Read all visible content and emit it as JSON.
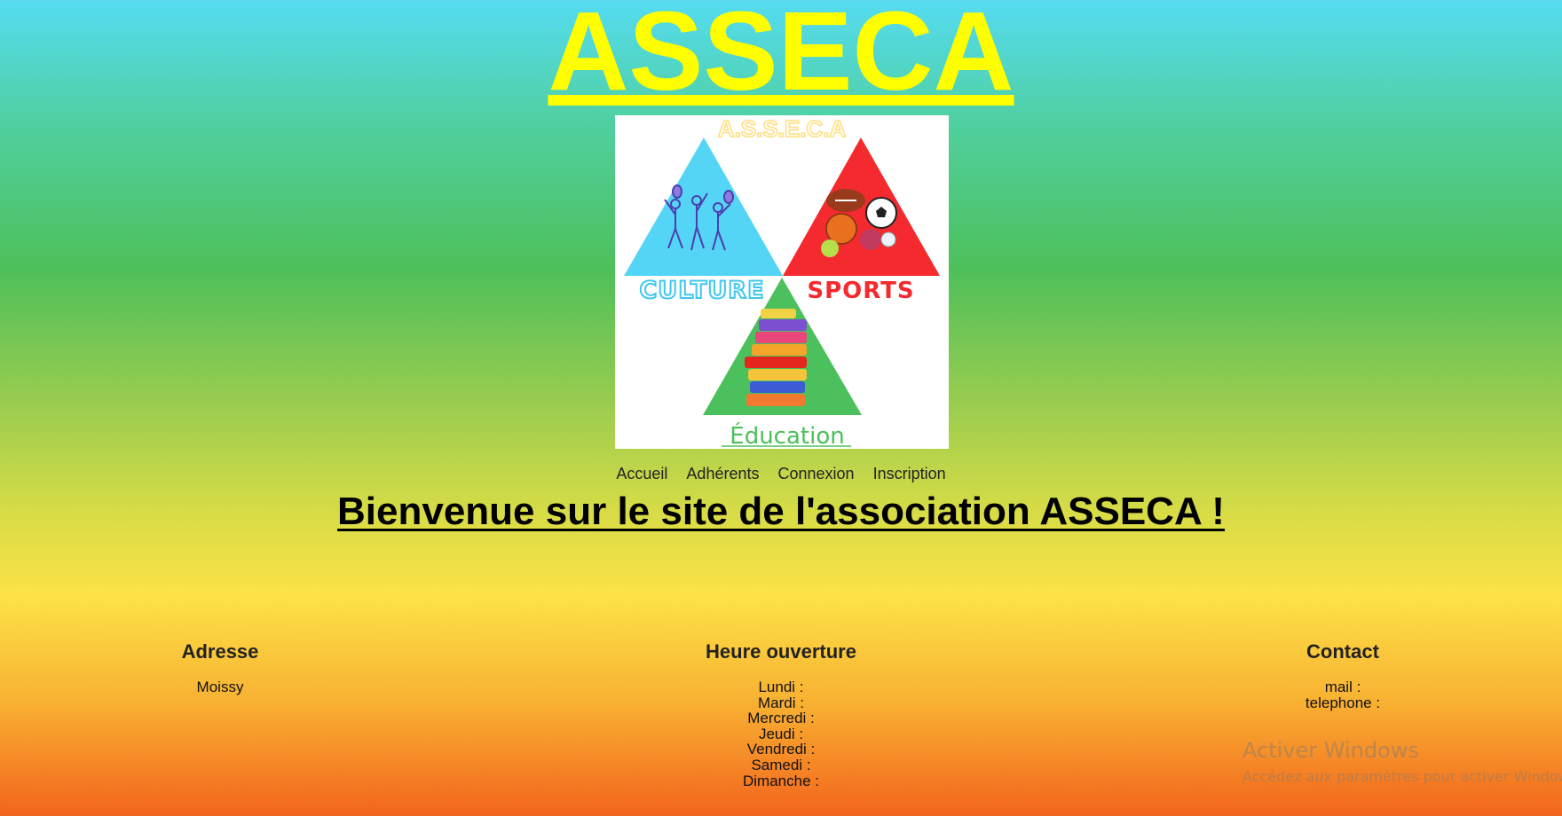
{
  "site": {
    "title": "ASSECA"
  },
  "logo": {
    "top_text": "A.S.S.E.C.A",
    "labels": {
      "culture": "CULTURE",
      "sports": "SPORTS",
      "education": "Éducation"
    },
    "colors": {
      "culture": "#55d5f5",
      "sports": "#f42a2f",
      "education": "#4bc05c",
      "top_text": "#ffe083"
    }
  },
  "nav": {
    "items": [
      {
        "label": "Accueil"
      },
      {
        "label": "Adhérents"
      },
      {
        "label": "Connexion"
      },
      {
        "label": "Inscription"
      }
    ]
  },
  "main": {
    "welcome": "Bienvenue sur le site de l'association ASSECA !"
  },
  "footer": {
    "address": {
      "heading": "Adresse",
      "lines": [
        "Moissy"
      ]
    },
    "hours": {
      "heading": "Heure ouverture",
      "lines": [
        "Lundi :",
        "Mardi :",
        "Mercredi :",
        "Jeudi :",
        "Vendredi :",
        "Samedi :",
        "Dimanche :"
      ]
    },
    "contact": {
      "heading": "Contact",
      "lines": [
        "mail :",
        "telephone :"
      ]
    }
  },
  "watermark": {
    "line1": "Activer Windows",
    "line2": "Accédez aux paramètres pour activer Windows."
  },
  "theme": {
    "title_color": "#ffff00"
  }
}
